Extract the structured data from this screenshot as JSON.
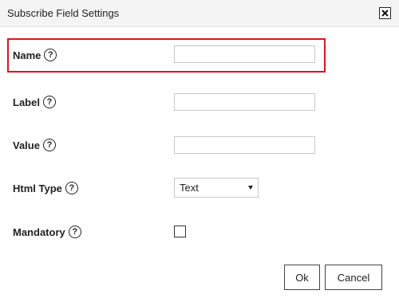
{
  "dialog": {
    "title": "Subscribe Field Settings",
    "close_icon": "close-icon"
  },
  "fields": {
    "name": {
      "label": "Name",
      "value": "",
      "help_icon": "question-circle-icon"
    },
    "label": {
      "label": "Label",
      "value": "",
      "help_icon": "question-circle-icon"
    },
    "value": {
      "label": "Value",
      "value": "",
      "help_icon": "question-circle-icon"
    },
    "html_type": {
      "label": "Html Type",
      "selected": "Text",
      "help_icon": "question-circle-icon"
    },
    "mandatory": {
      "label": "Mandatory",
      "checked": false,
      "help_icon": "question-circle-icon"
    }
  },
  "help_glyph": "?",
  "buttons": {
    "ok": "Ok",
    "cancel": "Cancel"
  },
  "colors": {
    "highlight_border": "#e0141e",
    "titlebar_bg": "#f4f4f4"
  }
}
